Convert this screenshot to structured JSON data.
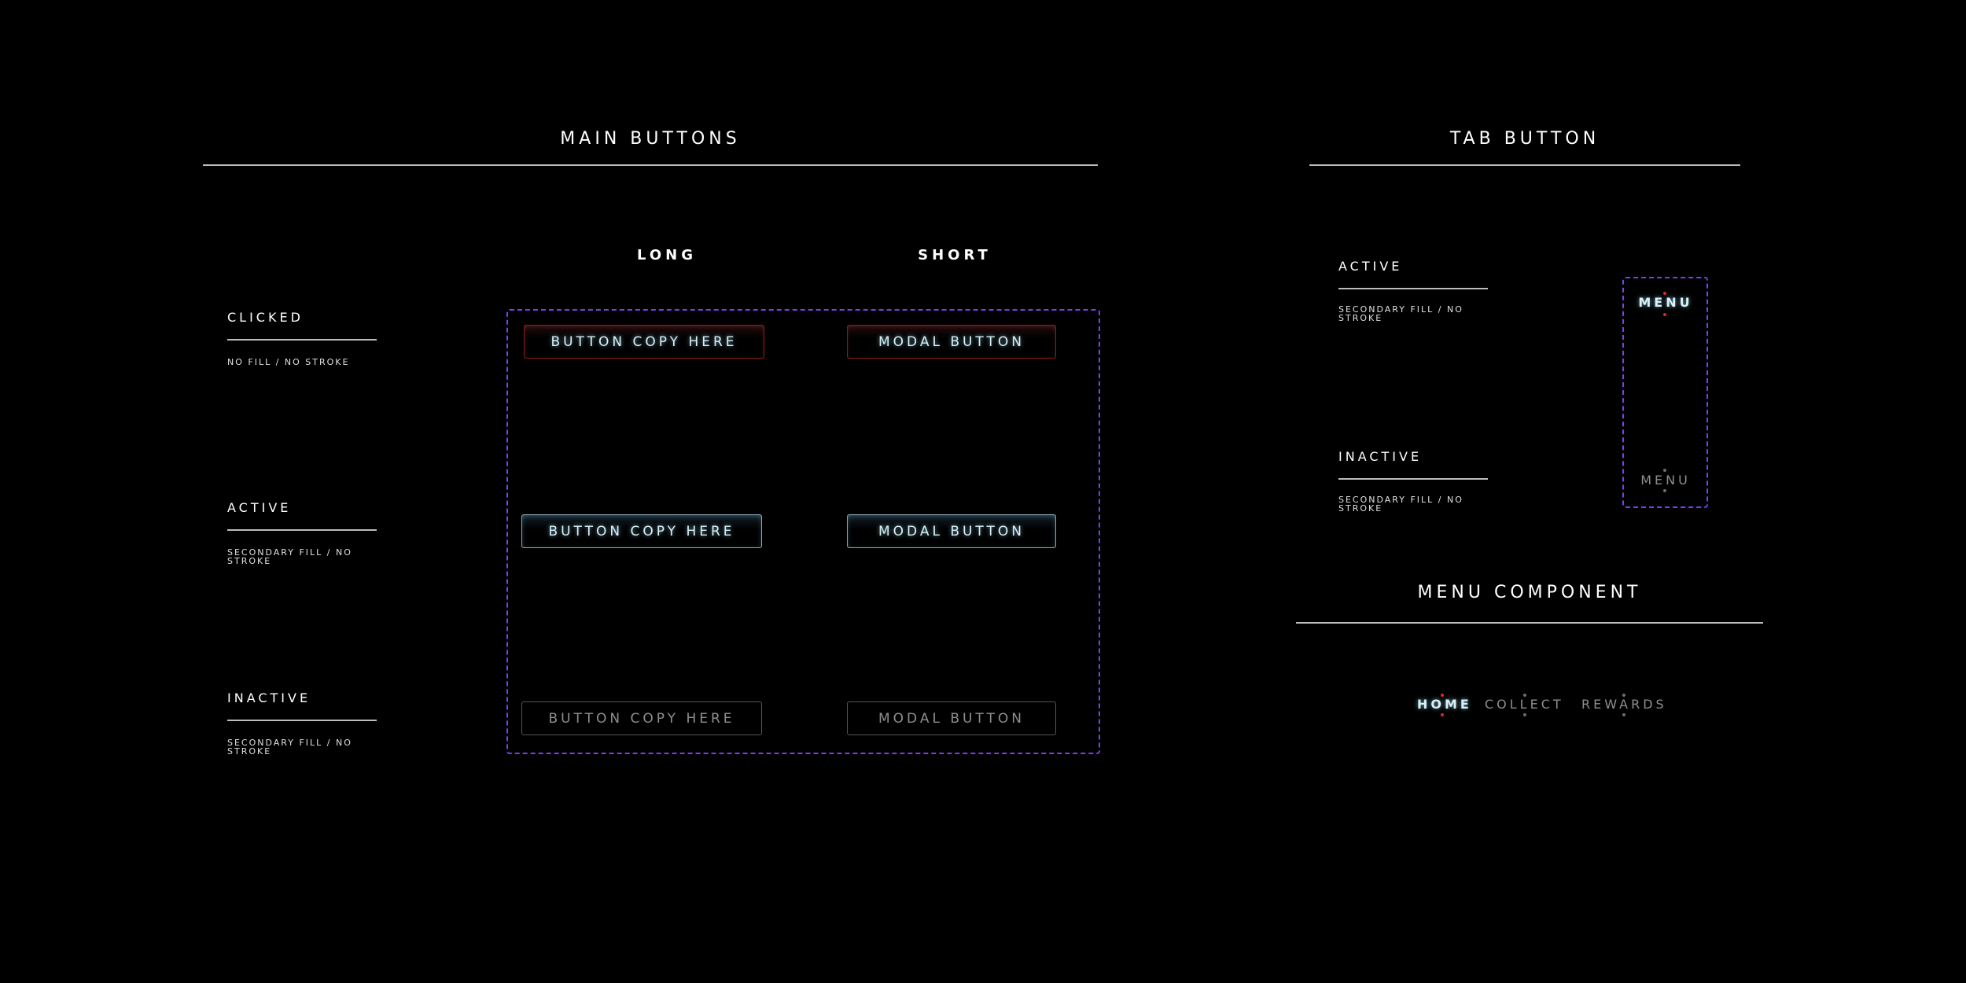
{
  "main_buttons": {
    "title": "MAIN BUTTONS",
    "columns": {
      "long": "LONG",
      "short": "SHORT"
    },
    "states": {
      "clicked": {
        "label": "CLICKED",
        "desc": "NO FILL / NO STROKE"
      },
      "active": {
        "label": "ACTIVE",
        "desc": "SECONDARY FILL / NO STROKE"
      },
      "inactive": {
        "label": "INACTIVE",
        "desc": "SECONDARY FILL / NO STROKE"
      }
    },
    "long_label": "BUTTON COPY HERE",
    "short_label": "MODAL BUTTON"
  },
  "tab_button": {
    "title": "TAB BUTTON",
    "states": {
      "active": {
        "label": "ACTIVE",
        "desc": "SECONDARY FILL / NO STROKE"
      },
      "inactive": {
        "label": "INACTIVE",
        "desc": "SECONDARY FILL / NO STROKE"
      }
    },
    "tab_label": "MENU"
  },
  "menu_component": {
    "title": "MENU COMPONENT",
    "items": [
      "HOME",
      "COLLECT",
      "REWARDS"
    ],
    "active_item": "HOME"
  },
  "colors": {
    "background": "#000000",
    "dashed_frame": "#7b3ff0",
    "clicked_stroke": "#8c1a1a",
    "active_text": "#d8f0f7",
    "inactive_text": "#8e8e8e",
    "indicator_dot": "#e0282a"
  }
}
